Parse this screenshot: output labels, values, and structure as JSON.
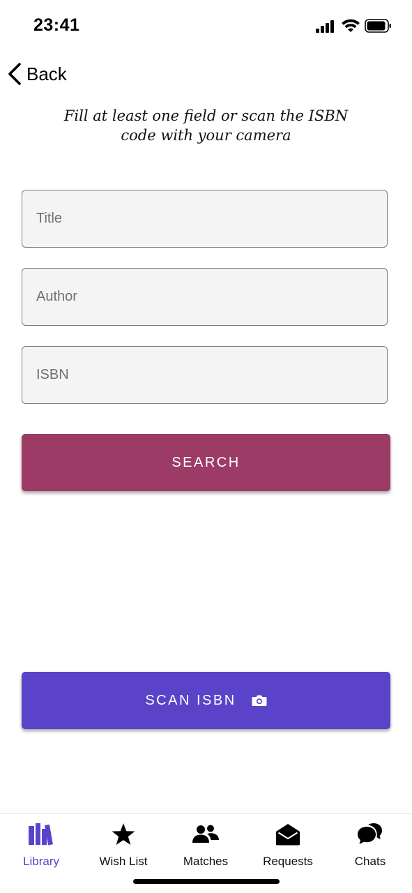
{
  "status_bar": {
    "time": "23:41",
    "icons": [
      "signal-icon",
      "wifi-icon",
      "battery-icon"
    ]
  },
  "nav": {
    "back_label": "Back",
    "back_icon": "chevron-left-icon"
  },
  "instructions": "Fill at least one field or scan the ISBN code with your camera",
  "form": {
    "title_placeholder": "Title",
    "title_value": "",
    "author_placeholder": "Author",
    "author_value": "",
    "isbn_placeholder": "ISBN",
    "isbn_value": ""
  },
  "buttons": {
    "search_label": "SEARCH",
    "scan_label": "SCAN ISBN",
    "scan_icon": "camera-icon"
  },
  "tabs": [
    {
      "label": "Library",
      "icon": "books-icon",
      "active": true
    },
    {
      "label": "Wish List",
      "icon": "star-icon",
      "active": false
    },
    {
      "label": "Matches",
      "icon": "people-icon",
      "active": false
    },
    {
      "label": "Requests",
      "icon": "envelope-open-icon",
      "active": false
    },
    {
      "label": "Chats",
      "icon": "chat-bubbles-icon",
      "active": false
    }
  ],
  "colors": {
    "search_button": "#9c3b66",
    "scan_button": "#5a43c9",
    "active_tab": "#5a43c9",
    "field_background": "#f4f4f4"
  }
}
